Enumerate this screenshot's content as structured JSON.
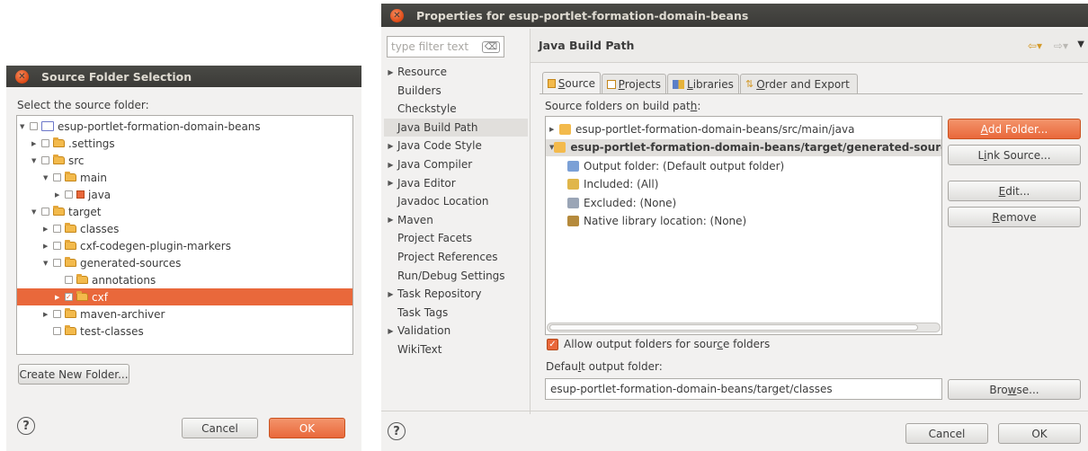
{
  "dialog1": {
    "title": "Source Folder Selection",
    "prompt": "Select the source folder:",
    "tree": [
      {
        "label": "esup-portlet-formation-domain-beans",
        "expanded": true
      },
      {
        "label": ".settings"
      },
      {
        "label": "src",
        "expanded": true
      },
      {
        "label": "main",
        "expanded": true
      },
      {
        "label": "java"
      },
      {
        "label": "target",
        "expanded": true
      },
      {
        "label": "classes"
      },
      {
        "label": "cxf-codegen-plugin-markers"
      },
      {
        "label": "generated-sources",
        "expanded": true
      },
      {
        "label": "annotations"
      },
      {
        "label": "cxf",
        "selected": true,
        "checked": true
      },
      {
        "label": "maven-archiver"
      },
      {
        "label": "test-classes"
      }
    ],
    "create_button": "Create New Folder...",
    "help": "?",
    "cancel": "Cancel",
    "ok": "OK"
  },
  "dialog2": {
    "title": "Properties for esup-portlet-formation-domain-beans",
    "filter_placeholder": "type filter text",
    "nav": [
      {
        "label": "Resource",
        "arrow": true
      },
      {
        "label": "Builders"
      },
      {
        "label": "Checkstyle"
      },
      {
        "label": "Java Build Path",
        "selected": true
      },
      {
        "label": "Java Code Style",
        "arrow": true
      },
      {
        "label": "Java Compiler",
        "arrow": true
      },
      {
        "label": "Java Editor",
        "arrow": true
      },
      {
        "label": "Javadoc Location"
      },
      {
        "label": "Maven",
        "arrow": true
      },
      {
        "label": "Project Facets"
      },
      {
        "label": "Project References"
      },
      {
        "label": "Run/Debug Settings"
      },
      {
        "label": "Task Repository",
        "arrow": true
      },
      {
        "label": "Task Tags"
      },
      {
        "label": "Validation",
        "arrow": true
      },
      {
        "label": "WikiText"
      }
    ],
    "page_title": "Java Build Path",
    "tabs": {
      "source": {
        "icon": "source-folder-icon",
        "before": "",
        "mnemonic": "S",
        "after": "ource"
      },
      "projects": {
        "icon": "projects-icon",
        "before": "",
        "mnemonic": "P",
        "after": "rojects"
      },
      "libraries": {
        "icon": "libraries-icon",
        "before": "",
        "mnemonic": "L",
        "after": "ibraries"
      },
      "order": {
        "icon": "order-export-icon",
        "before": "",
        "mnemonic": "O",
        "after": "rder and Export"
      }
    },
    "folders_label_before": "Source folders on build pat",
    "folders_label_mnemonic": "h",
    "folders_label_after": ":",
    "source_tree": [
      {
        "label": "esup-portlet-formation-domain-beans/src/main/java",
        "level": 0
      },
      {
        "label": "esup-portlet-formation-domain-beans/target/generated-sources/cxf",
        "level": 0,
        "expanded": true
      },
      {
        "label": "Output folder: (Default output folder)",
        "level": 1
      },
      {
        "label": "Included: (All)",
        "level": 1
      },
      {
        "label": "Excluded: (None)",
        "level": 1
      },
      {
        "label": "Native library location: (None)",
        "level": 1
      }
    ],
    "buttons": {
      "add_folder": {
        "before": "",
        "mnemonic": "A",
        "after": "dd Folder..."
      },
      "link_source": {
        "before": "L",
        "mnemonic": "i",
        "after": "nk Source..."
      },
      "edit": {
        "before": "",
        "mnemonic": "E",
        "after": "dit..."
      },
      "remove": {
        "before": "",
        "mnemonic": "R",
        "after": "emove"
      }
    },
    "allow_output_before": "Allow output folders for sour",
    "allow_output_mnemonic": "c",
    "allow_output_after": "e folders",
    "allow_output_checked": true,
    "default_output_before": "Defau",
    "default_output_mnemonic": "l",
    "default_output_after": "t output folder:",
    "default_output_value": "esup-portlet-formation-domain-beans/target/classes",
    "browse_before": "Bro",
    "browse_mnemonic": "w",
    "browse_after": "se...",
    "help": "?",
    "cancel": "Cancel",
    "ok": "OK"
  },
  "colors": {
    "accent": "#e9683b",
    "titlebar": "#3c3b37",
    "selection_nav": "#e1dfdc",
    "dialog_bg": "#f2f1f0"
  }
}
